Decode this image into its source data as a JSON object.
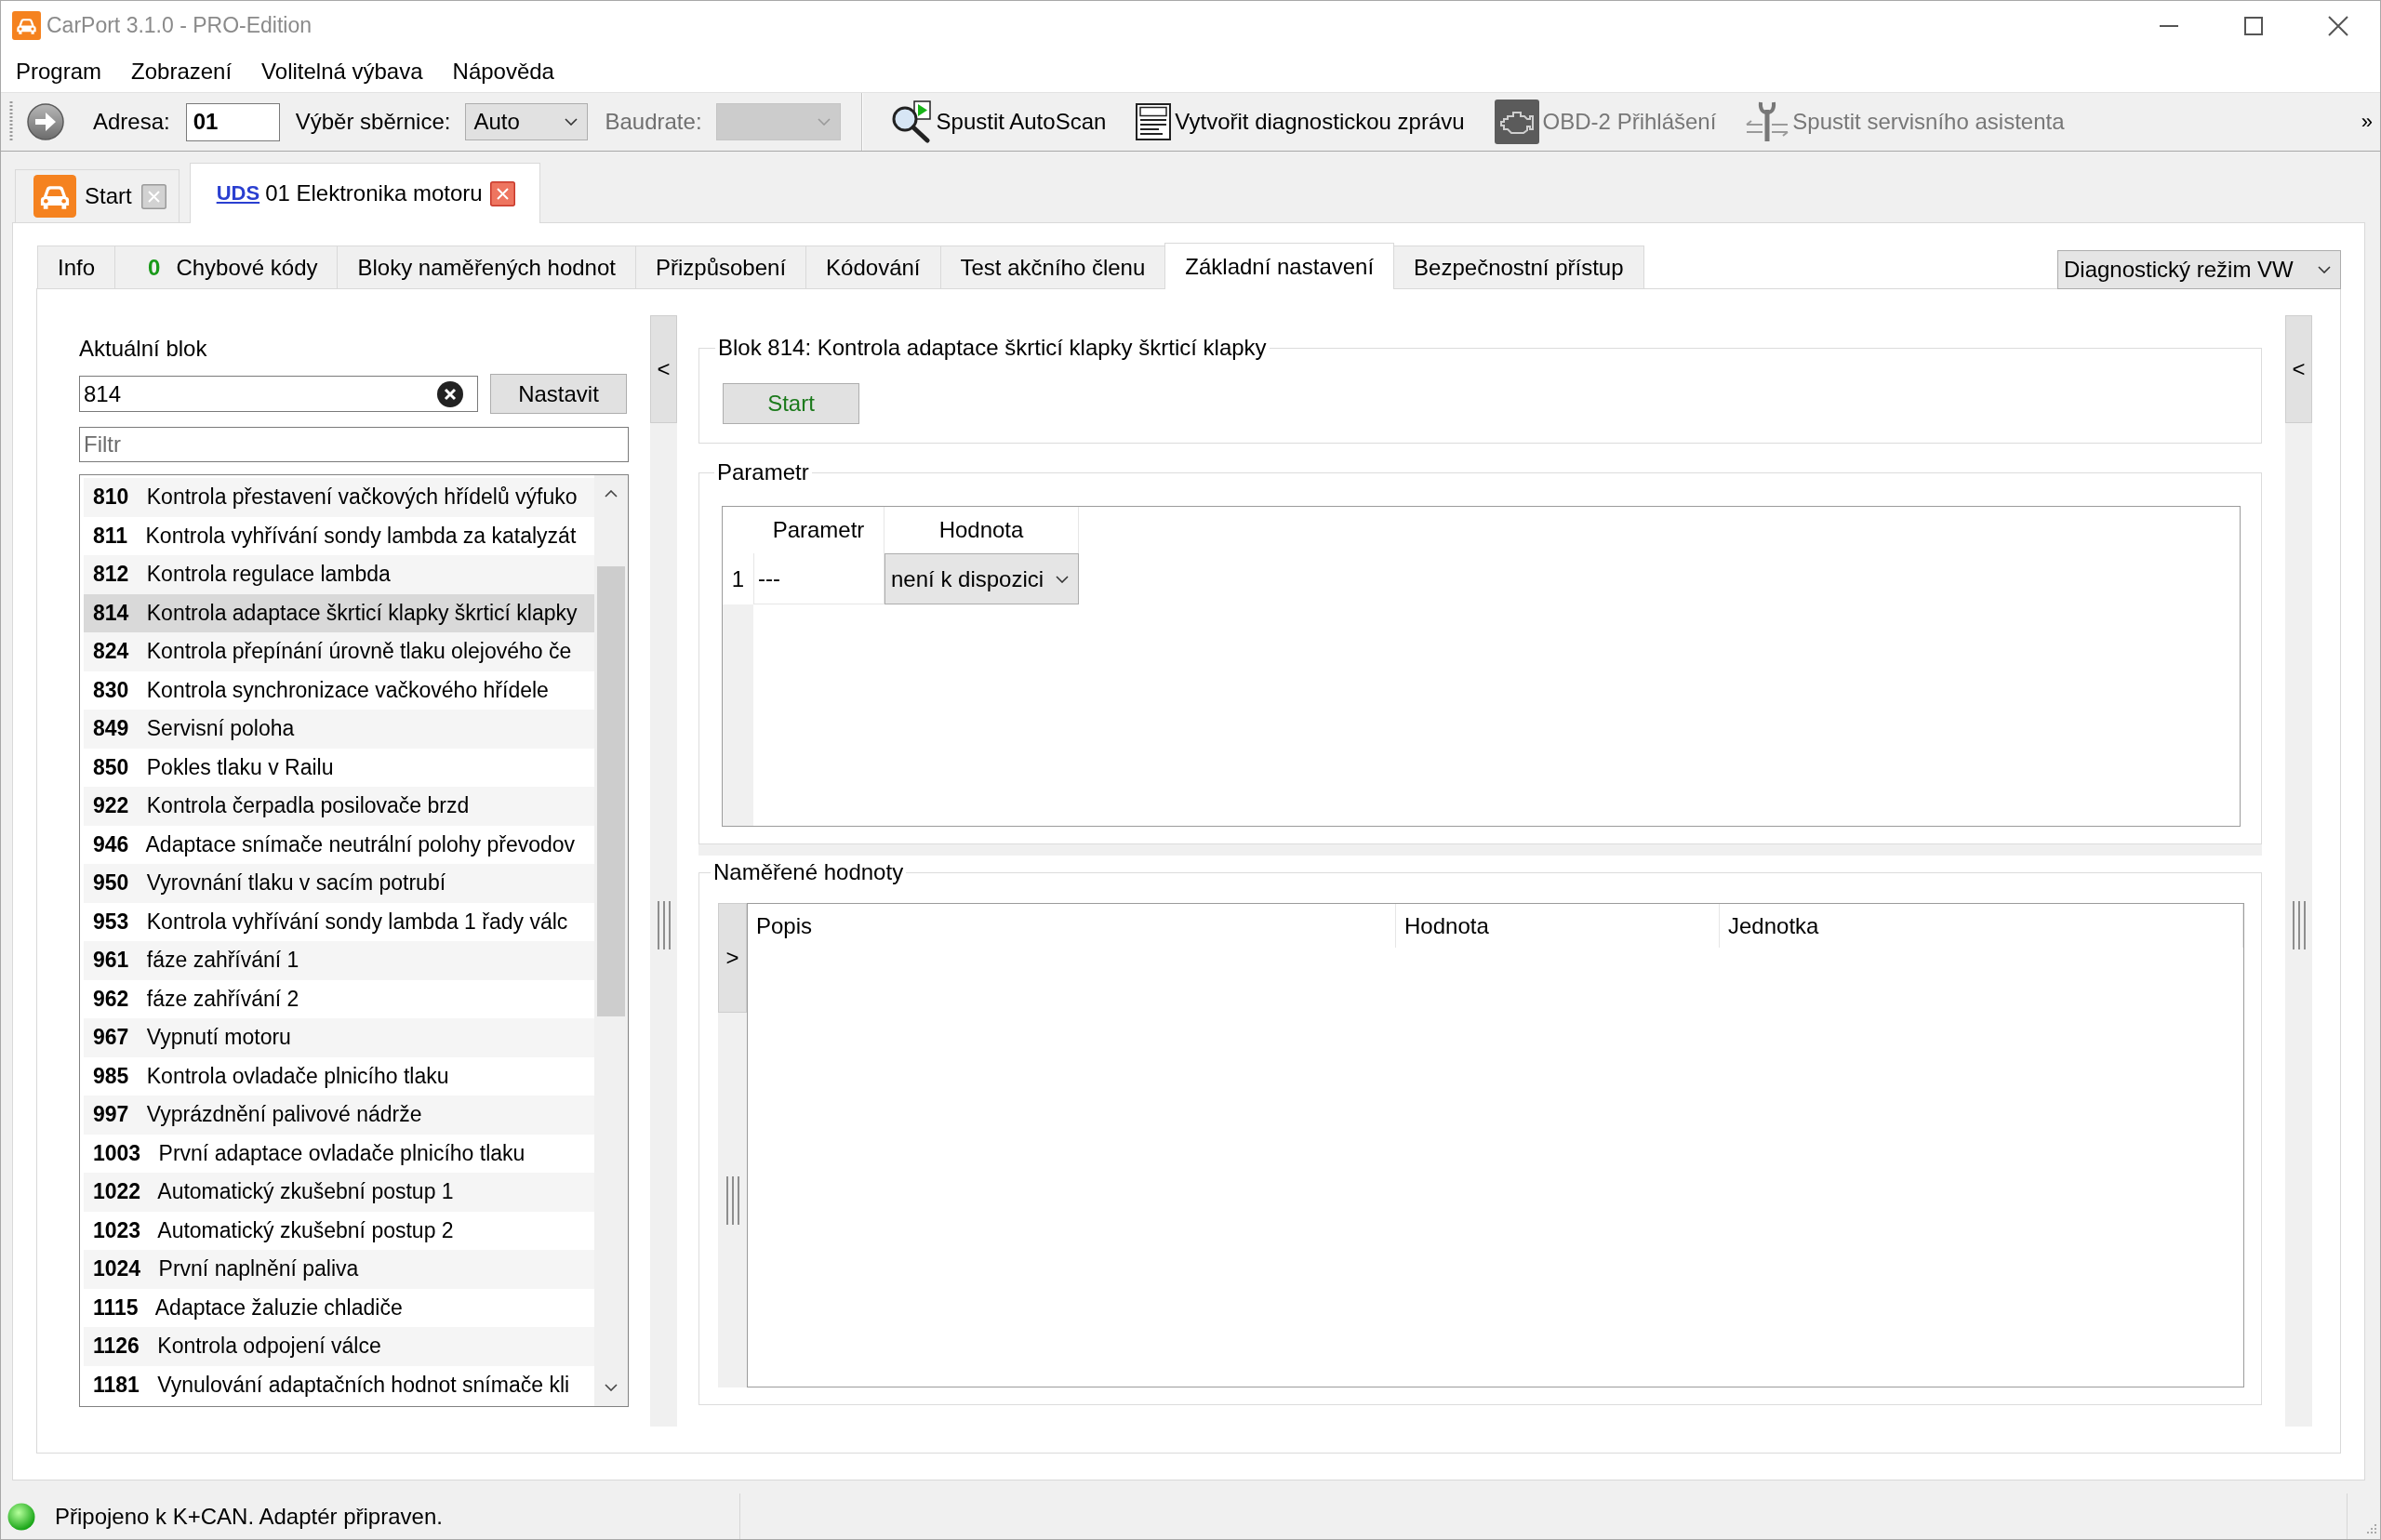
{
  "window": {
    "title": "CarPort 3.1.0 - PRO-Edition"
  },
  "menu": [
    "Program",
    "Zobrazení",
    "Volitelná výbava",
    "Nápověda"
  ],
  "toolbar": {
    "address": {
      "label": "Adresa:",
      "value": "01"
    },
    "bus": {
      "label": "Výběr sběrnice:",
      "value": "Auto"
    },
    "baudrate": {
      "label": "Baudrate:",
      "disabled": true
    },
    "actions": [
      {
        "kind": "autoscan",
        "label": "Spustit AutoScan",
        "disabled": false
      },
      {
        "kind": "report",
        "label": "Vytvořit diagnostickou zprávu",
        "disabled": false
      },
      {
        "kind": "obd",
        "label": "OBD-2 Přihlášení",
        "disabled": true
      },
      {
        "kind": "service",
        "label": "Spustit servisního asistenta",
        "disabled": true
      }
    ],
    "overflow": "»"
  },
  "document_tabs": [
    {
      "kind": "start",
      "label": "Start",
      "selected": false
    },
    {
      "kind": "uds",
      "badge": "UDS",
      "label": "01 Elektronika motoru",
      "selected": true
    }
  ],
  "tabs": [
    {
      "label": "Info",
      "selected": false
    },
    {
      "count": "0",
      "label": "Chybové kódy",
      "selected": false
    },
    {
      "label": "Bloky naměřených hodnot",
      "selected": false
    },
    {
      "label": "Přizpůsobení",
      "selected": false
    },
    {
      "label": "Kódování",
      "selected": false
    },
    {
      "label": "Test akčního členu",
      "selected": false
    },
    {
      "label": "Základní nastavení",
      "selected": true
    },
    {
      "label": "Bezpečnostní přístup",
      "selected": false
    }
  ],
  "mode": "Diagnostický režim VW",
  "block_panel": {
    "label": "Aktuální blok",
    "value": "814",
    "button": "Nastavit",
    "filter_placeholder": "Filtr",
    "items": [
      {
        "number": "810",
        "name": "Kontrola přestavení vačkových hřídelů výfuko",
        "selected": false
      },
      {
        "number": "811",
        "name": "Kontrola vyhřívání sondy lambda za katalyzát",
        "selected": false
      },
      {
        "number": "812",
        "name": "Kontrola regulace lambda",
        "selected": false
      },
      {
        "number": "814",
        "name": "Kontrola adaptace škrticí klapky škrticí klapky",
        "selected": true
      },
      {
        "number": "824",
        "name": "Kontrola přepínání úrovně tlaku olejového če",
        "selected": false
      },
      {
        "number": "830",
        "name": "Kontrola synchronizace vačkového hřídele",
        "selected": false
      },
      {
        "number": "849",
        "name": "Servisní poloha",
        "selected": false
      },
      {
        "number": "850",
        "name": "Pokles tlaku v Railu",
        "selected": false
      },
      {
        "number": "922",
        "name": "Kontrola čerpadla posilovače brzd",
        "selected": false
      },
      {
        "number": "946",
        "name": "Adaptace snímače neutrální polohy převodov",
        "selected": false
      },
      {
        "number": "950",
        "name": "Vyrovnání tlaku v sacím potrubí",
        "selected": false
      },
      {
        "number": "953",
        "name": "Kontrola vyhřívání sondy lambda 1 řady válc",
        "selected": false
      },
      {
        "number": "961",
        "name": "fáze zahřívání 1",
        "selected": false
      },
      {
        "number": "962",
        "name": "fáze zahřívání 2",
        "selected": false
      },
      {
        "number": "967",
        "name": "Vypnutí motoru",
        "selected": false
      },
      {
        "number": "985",
        "name": "Kontrola ovladače plnicího tlaku",
        "selected": false
      },
      {
        "number": "997",
        "name": "Vyprázdnění palivové nádrže",
        "selected": false
      },
      {
        "number": "1003",
        "name": "První adaptace ovladače plnicího tlaku",
        "selected": false
      },
      {
        "number": "1022",
        "name": "Automatický zkušební postup 1",
        "selected": false
      },
      {
        "number": "1023",
        "name": "Automatický zkušební postup 2",
        "selected": false
      },
      {
        "number": "1024",
        "name": "První naplnění paliva",
        "selected": false
      },
      {
        "number": "1115",
        "name": "Adaptace žaluzie chladiče",
        "selected": false
      },
      {
        "number": "1126",
        "name": "Kontrola odpojení válce",
        "selected": false
      },
      {
        "number": "1181",
        "name": "Vynulování adaptačních hodnot snímače kli",
        "selected": false
      }
    ]
  },
  "basic_settings": {
    "left_toggle": "<",
    "block": {
      "title": "Blok 814: Kontrola adaptace škrticí klapky škrticí klapky",
      "button": "Start"
    },
    "parameters": {
      "title": "Parametr",
      "columns": [
        "Parametr",
        "Hodnota"
      ],
      "rows": [
        {
          "number": "1",
          "parameter": "---",
          "value": "není k dispozici"
        }
      ]
    },
    "measured": {
      "title": "Naměřené hodnoty",
      "toggle": ">",
      "columns": [
        "Popis",
        "Hodnota",
        "Jednotka"
      ]
    },
    "right_toggle": "<"
  },
  "status_bar": {
    "connected": true,
    "text": "Připojeno k K+CAN. Adaptér připraven."
  }
}
